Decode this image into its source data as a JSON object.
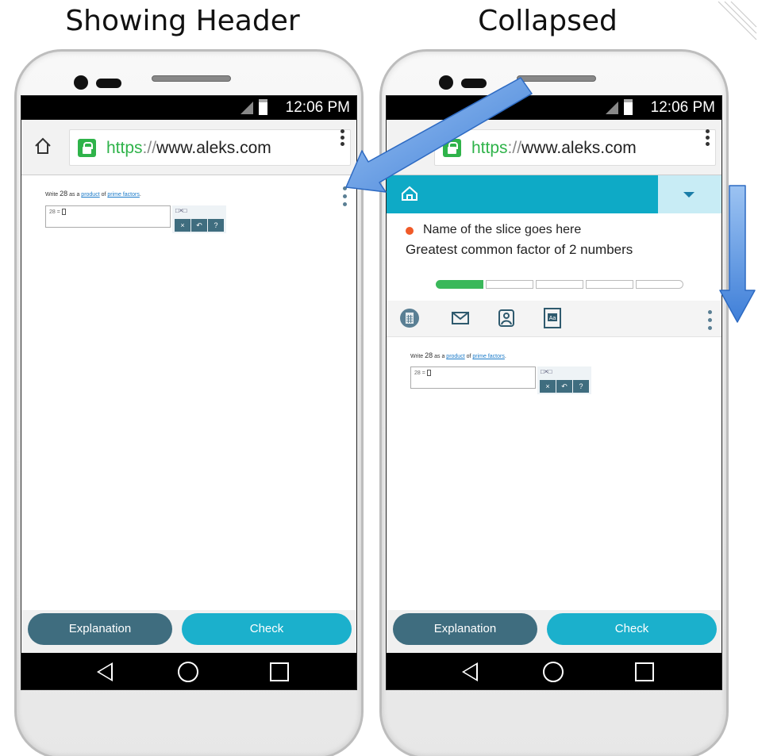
{
  "captions": {
    "left": "Showing Header",
    "right": "Collapsed"
  },
  "status": {
    "time": "12:06 PM"
  },
  "browser": {
    "url_scheme": "https",
    "url_sep": "://",
    "url_host": "www.aleks.com"
  },
  "question": {
    "prefix": "Write ",
    "number": "28",
    "mid": " as a ",
    "link1": "product",
    "of": " of ",
    "link2": "prime factors",
    "end": ".",
    "answer_prefix": "28 ="
  },
  "tools": {
    "times": "□×□",
    "clear": "×",
    "undo": "↶",
    "help": "?"
  },
  "footer": {
    "explanation": "Explanation",
    "check": "Check"
  },
  "header": {
    "slice_name": "Name of the slice goes here",
    "topic_title": "Greatest common factor of 2 numbers",
    "progress_filled_segments": 1,
    "progress_total_segments": 5,
    "tool_icons": [
      "calculator-icon",
      "mail-icon",
      "worksheet-icon",
      "dictionary-icon"
    ],
    "accent_color": "#0eaac6"
  }
}
